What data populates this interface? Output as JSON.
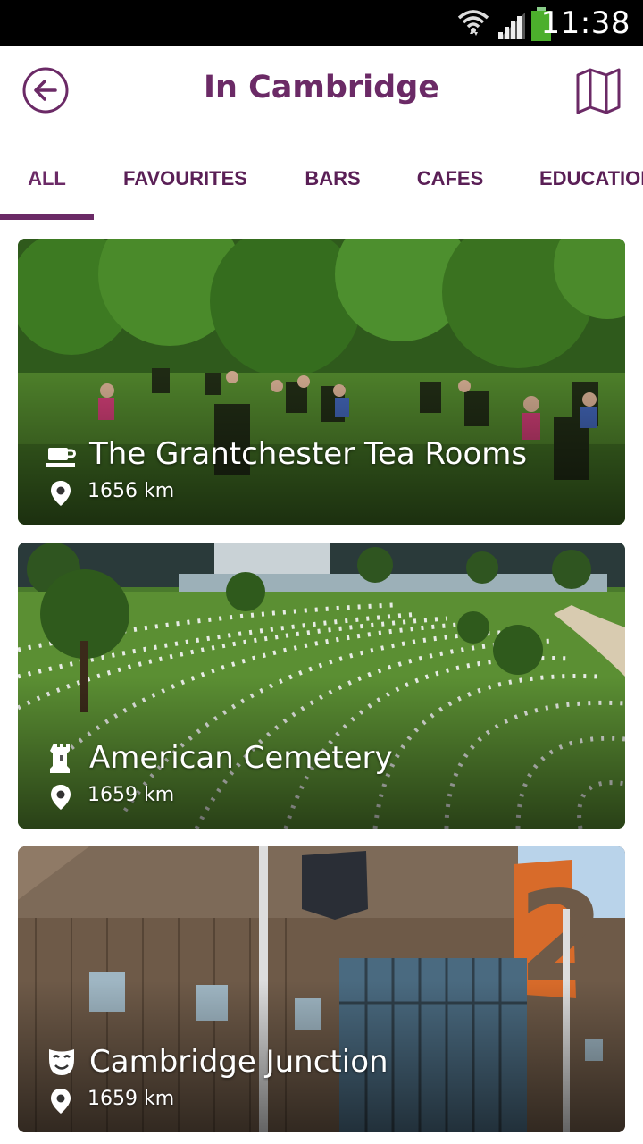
{
  "status_bar": {
    "time": "11:38"
  },
  "header": {
    "title": "In Cambridge",
    "back_icon": "back-arrow-icon",
    "map_icon": "map-icon"
  },
  "tabs": [
    {
      "label": "ALL",
      "active": true
    },
    {
      "label": "FAVOURITES",
      "active": false
    },
    {
      "label": "BARS",
      "active": false
    },
    {
      "label": "CAFES",
      "active": false
    },
    {
      "label": "EDUCATION",
      "active": false
    }
  ],
  "places": [
    {
      "name": "The Grantchester Tea Rooms",
      "distance": "1656 km",
      "category_icon": "cafe-cup-icon"
    },
    {
      "name": "American Cemetery",
      "distance": "1659 km",
      "category_icon": "tower-icon"
    },
    {
      "name": "Cambridge Junction",
      "distance": "1659 km",
      "category_icon": "theatre-mask-icon"
    }
  ],
  "colors": {
    "accent": "#6b2a66",
    "tab_text": "#5a1f56"
  }
}
